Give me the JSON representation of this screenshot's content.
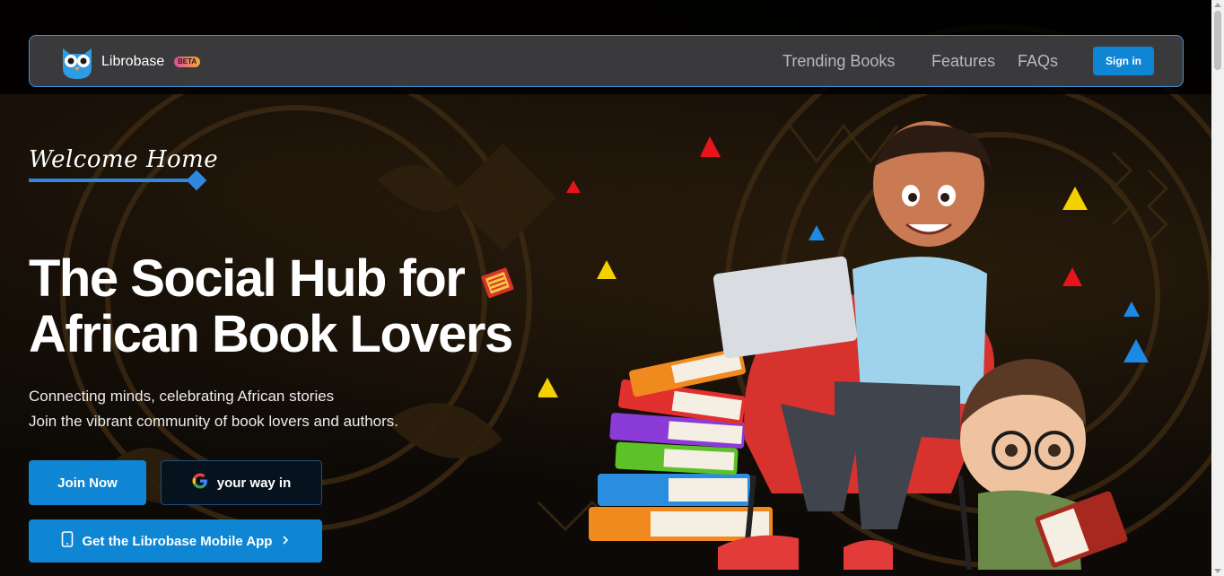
{
  "navbar": {
    "brand": "Librobase",
    "badge": "BETA",
    "links": [
      "Trending Books",
      "Features",
      "FAQs"
    ],
    "signin_label": "Sign in"
  },
  "hero": {
    "welcome": "Welcome Home",
    "title_line1": "The Social Hub for",
    "title_line2": "African Book Lovers",
    "subtitle_line1": "Connecting minds, celebrating African stories",
    "subtitle_line2": "Join the vibrant community of book lovers and authors.",
    "join_label": "Join Now",
    "google_label": "your way in",
    "mobile_label": "Get the Librobase Mobile App"
  },
  "icons": [
    "owl-logo-icon",
    "books-emoji-icon",
    "google-icon",
    "phone-icon",
    "chevron-right-icon"
  ],
  "colors": {
    "accent": "#0e86d4",
    "nav_bg": "#3a3a3c",
    "nav_border": "#3b8fd6"
  }
}
